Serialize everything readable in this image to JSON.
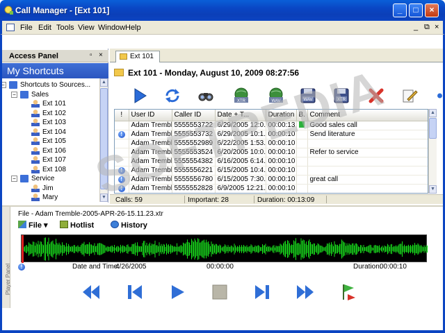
{
  "window": {
    "title": "Call Manager - [Ext 101]",
    "controls": {
      "minimize": "_",
      "maximize": "□",
      "close": "×"
    }
  },
  "menu": [
    "File",
    "Edit",
    "Tools",
    "View",
    "Window",
    "Help"
  ],
  "mdi_controls": {
    "minimize": "_",
    "restore": "⧉",
    "close": "×"
  },
  "access_panel": {
    "title": "Access Panel",
    "pin": "▫",
    "close": "×",
    "heading": "My Shortcuts",
    "tree": [
      {
        "label": "Shortcuts to Sources...",
        "level": 0,
        "type": "folder",
        "expander": "−"
      },
      {
        "label": "Sales",
        "level": 1,
        "type": "folder",
        "expander": "−"
      },
      {
        "label": "Ext 101",
        "level": 2,
        "type": "user"
      },
      {
        "label": "Ext 102",
        "level": 2,
        "type": "user"
      },
      {
        "label": "Ext 103",
        "level": 2,
        "type": "user"
      },
      {
        "label": "Ext 104",
        "level": 2,
        "type": "user"
      },
      {
        "label": "Ext 105",
        "level": 2,
        "type": "user"
      },
      {
        "label": "Ext 106",
        "level": 2,
        "type": "user"
      },
      {
        "label": "Ext 107",
        "level": 2,
        "type": "user"
      },
      {
        "label": "Ext 108",
        "level": 2,
        "type": "user"
      },
      {
        "label": "Service",
        "level": 1,
        "type": "folder",
        "expander": "−"
      },
      {
        "label": "Jim",
        "level": 2,
        "type": "user"
      },
      {
        "label": "Mary",
        "level": 2,
        "type": "user"
      }
    ]
  },
  "tab": {
    "label": "Ext 101"
  },
  "header": {
    "title": "Ext 101 - Monday, August 10, 2009 08:27:56"
  },
  "toolbar": [
    {
      "name": "play-icon",
      "label": ""
    },
    {
      "name": "refresh-icon",
      "label": ""
    },
    {
      "name": "binoculars-icon",
      "label": ""
    },
    {
      "name": "globe-xtr-icon",
      "label": "XTR"
    },
    {
      "name": "globe-wav-icon",
      "label": "WAV"
    },
    {
      "name": "save-wav-icon",
      "label": "WAV"
    },
    {
      "name": "save-xtr-icon",
      "label": "XTR"
    },
    {
      "name": "delete-icon",
      "label": ""
    },
    {
      "name": "edit-icon",
      "label": ""
    }
  ],
  "grid": {
    "columns": [
      "!",
      "User ID",
      "Caller ID",
      "Date + T...",
      "Duration",
      "B.",
      "Comment"
    ],
    "rows": [
      {
        "imp": false,
        "user": "Adam Tremble",
        "caller": "5555553722",
        "date": "6/29/2005 12:0...",
        "duration": "00:00:13",
        "b": true,
        "comment": "Good sales call"
      },
      {
        "imp": true,
        "user": "Adam Tremble",
        "caller": "5555553732",
        "date": "6/29/2005 10:1...",
        "duration": "00:00:10",
        "b": false,
        "comment": "Send literature"
      },
      {
        "imp": false,
        "user": "Adam Tremble",
        "caller": "5555552989",
        "date": "6/22/2005 1:53...",
        "duration": "00:00:10",
        "b": false,
        "comment": ""
      },
      {
        "imp": false,
        "user": "Adam Tremble",
        "caller": "5555553524",
        "date": "6/20/2005 10:0...",
        "duration": "00:00:10",
        "b": false,
        "comment": "Refer to service"
      },
      {
        "imp": false,
        "user": "Adam Tremble",
        "caller": "5555554382",
        "date": "6/16/2005 6:14...",
        "duration": "00:00:10",
        "b": false,
        "comment": ""
      },
      {
        "imp": true,
        "user": "Adam Tremble",
        "caller": "5555556221",
        "date": "6/15/2005 10:4...",
        "duration": "00:00:10",
        "b": false,
        "comment": ""
      },
      {
        "imp": true,
        "user": "Adam Tremble",
        "caller": "5555556780",
        "date": "6/15/2005 7:30...",
        "duration": "00:00:10",
        "b": false,
        "comment": "great call"
      },
      {
        "imp": true,
        "user": "Adam Tremble",
        "caller": "5555552828",
        "date": "6/9/2005 12:21...",
        "duration": "00:00:10",
        "b": false,
        "comment": ""
      }
    ]
  },
  "status": {
    "calls": "Calls: 59",
    "important": "Important: 28",
    "duration": "Duration: 00:13:09"
  },
  "player": {
    "side_label": "Player Panel",
    "file": "File - Adam Tremble-2005-APR-26-15.11.23.xtr",
    "file_menu": "File",
    "hotlist": "Hotlist",
    "history": "History",
    "date_label": "Date and Time:",
    "date_value": "4/26/2005",
    "position": "00:00:00",
    "duration_label": "Duration:",
    "duration_value": "00:00:10",
    "playhead": 0.0
  },
  "watermark": "SOFTPEDIA",
  "colors": {
    "accent": "#0b45c2",
    "wave": "#19e01d",
    "playhead": "#e02020"
  }
}
